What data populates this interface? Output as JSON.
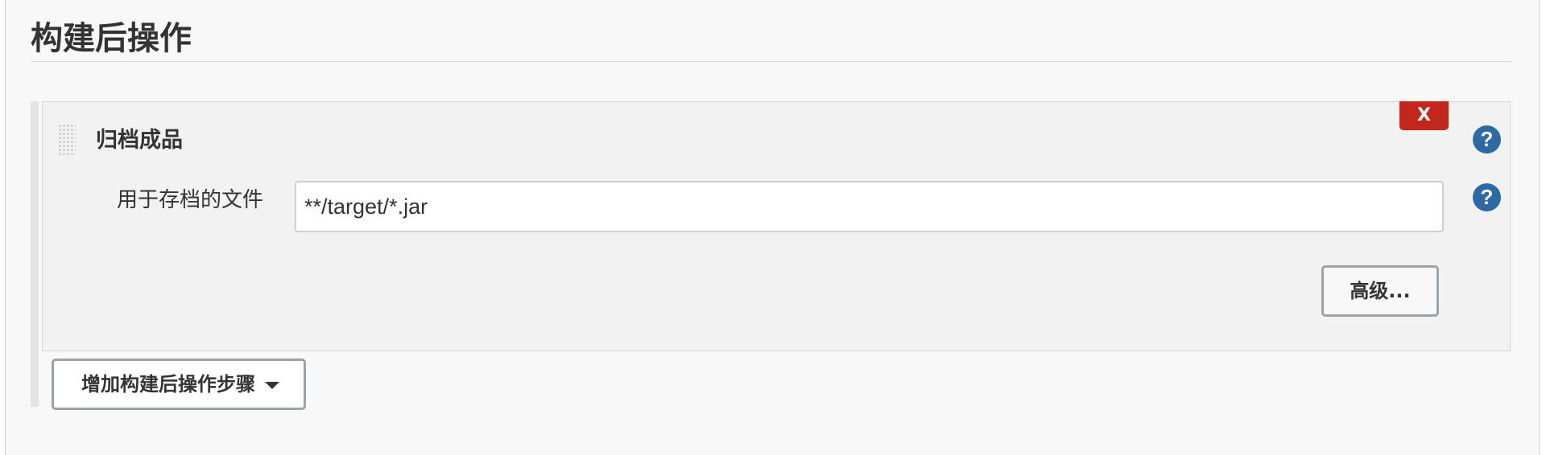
{
  "section": {
    "title": "构建后操作"
  },
  "step": {
    "title": "归档成品",
    "delete_label": "X",
    "field_label": "用于存档的文件",
    "field_value": "**/target/*.jar",
    "advanced_label": "高级..."
  },
  "help": {
    "symbol": "?"
  },
  "add_step": {
    "label": "增加构建后操作步骤"
  },
  "icons": {
    "delete": "close-icon",
    "help": "help-icon",
    "drag": "drag-handle-icon",
    "dropdown": "caret-down-icon"
  },
  "colors": {
    "delete_red": "#c1271d",
    "help_blue": "#2d6aa3",
    "panel_bg": "#f2f2f2",
    "page_bg": "#f8f8f8"
  }
}
